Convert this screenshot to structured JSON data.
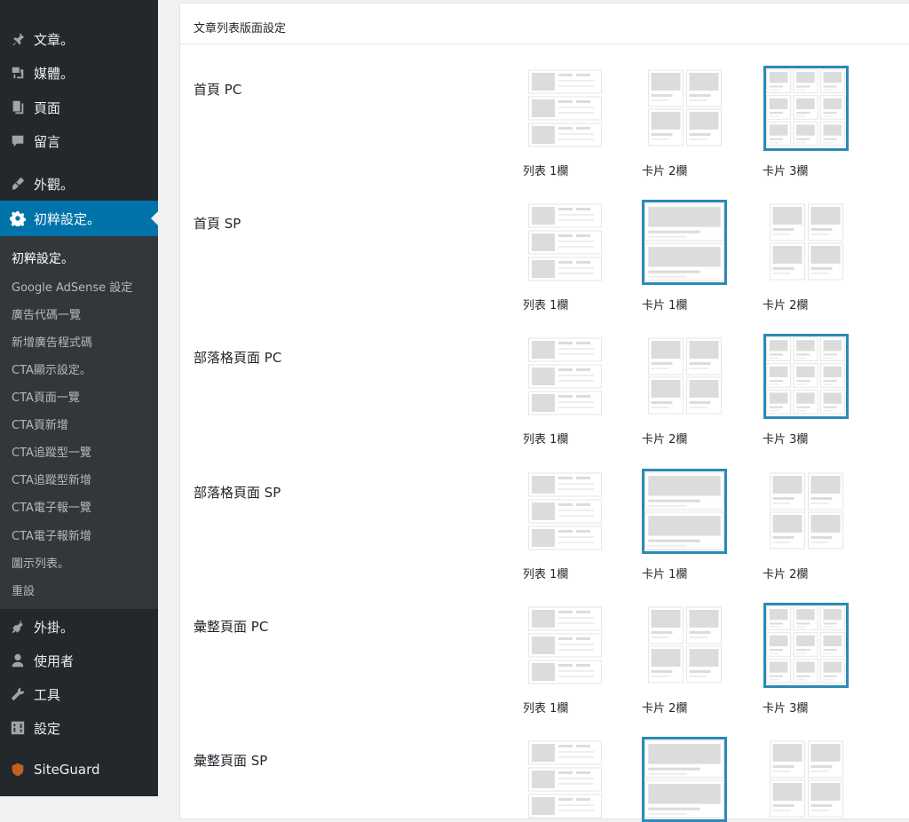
{
  "sidebar": {
    "items": [
      {
        "label": "文章。",
        "icon": "pin-icon"
      },
      {
        "label": "媒體。",
        "icon": "media-icon"
      },
      {
        "label": "頁面",
        "icon": "pages-icon"
      },
      {
        "label": "留言",
        "icon": "comments-icon"
      },
      {
        "label": "外觀。",
        "icon": "appearance-icon"
      },
      {
        "label": "初粹設定。",
        "icon": "gear-icon"
      },
      {
        "label": "外掛。",
        "icon": "plugins-icon"
      },
      {
        "label": "使用者",
        "icon": "users-icon"
      },
      {
        "label": "工具",
        "icon": "tools-icon"
      },
      {
        "label": "設定",
        "icon": "settings-icon"
      },
      {
        "label": "SiteGuard",
        "icon": "siteguard-icon"
      }
    ],
    "submenu": [
      "初粹設定。",
      "Google AdSense 設定",
      "廣告代碼一覽",
      "新增廣告程式碼",
      "CTA顯示設定。",
      "CTA頁面一覽",
      "CTA頁新增",
      "CTA追蹤型一覽",
      "CTA追蹤型新增",
      "CTA電子報一覽",
      "CTA電子報新增",
      "圖示列表。",
      "重設"
    ]
  },
  "panel": {
    "title": "文章列表版面設定",
    "rows": [
      {
        "label": "首頁 PC",
        "options": [
          "列表 1欄",
          "卡片 2欄",
          "卡片 3欄"
        ],
        "selected": 2
      },
      {
        "label": "首頁 SP",
        "options": [
          "列表 1欄",
          "卡片 1欄",
          "卡片 2欄"
        ],
        "selected": 1
      },
      {
        "label": "部落格頁面 PC",
        "options": [
          "列表 1欄",
          "卡片 2欄",
          "卡片 3欄"
        ],
        "selected": 2
      },
      {
        "label": "部落格頁面 SP",
        "options": [
          "列表 1欄",
          "卡片 1欄",
          "卡片 2欄"
        ],
        "selected": 1
      },
      {
        "label": "彙整頁面 PC",
        "options": [
          "列表 1欄",
          "卡片 2欄",
          "卡片 3欄"
        ],
        "selected": 2
      },
      {
        "label": "彙整頁面 SP",
        "options": [
          "",
          "",
          ""
        ],
        "selected": 1
      }
    ]
  },
  "colors": {
    "sidebar_bg": "#23282d",
    "submenu_bg": "#32373c",
    "active_bg": "#0073aa",
    "selected_border": "#2b8ab8"
  }
}
